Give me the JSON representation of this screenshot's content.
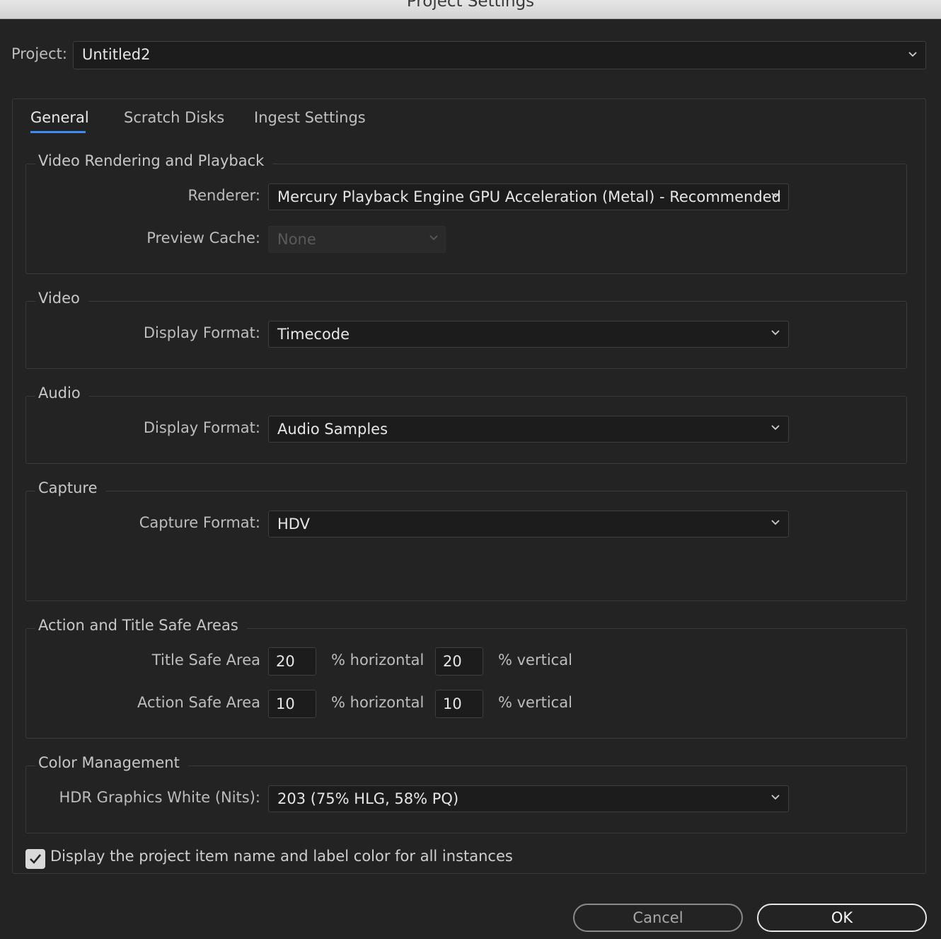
{
  "window": {
    "title": "Project Settings"
  },
  "project": {
    "label": "Project:",
    "value": "Untitled2"
  },
  "tabs": [
    {
      "label": "General",
      "active": true
    },
    {
      "label": "Scratch Disks",
      "active": false
    },
    {
      "label": "Ingest Settings",
      "active": false
    }
  ],
  "video_rendering": {
    "title": "Video Rendering and Playback",
    "renderer_label": "Renderer:",
    "renderer_value": "Mercury Playback Engine GPU Acceleration (Metal) - Recommended",
    "preview_cache_label": "Preview Cache:",
    "preview_cache_value": "None"
  },
  "video": {
    "title": "Video",
    "display_format_label": "Display Format:",
    "display_format_value": "Timecode"
  },
  "audio": {
    "title": "Audio",
    "display_format_label": "Display Format:",
    "display_format_value": "Audio Samples"
  },
  "capture": {
    "title": "Capture",
    "capture_format_label": "Capture Format:",
    "capture_format_value": "HDV"
  },
  "safe_areas": {
    "title": "Action and Title Safe Areas",
    "title_safe_label": "Title Safe Area",
    "title_safe_h": "20",
    "title_safe_v": "20",
    "action_safe_label": "Action Safe Area",
    "action_safe_h": "10",
    "action_safe_v": "10",
    "horizontal_unit": "% horizontal",
    "vertical_unit": "% vertical"
  },
  "color_management": {
    "title": "Color Management",
    "hdr_label": "HDR Graphics White (Nits):",
    "hdr_value": "203 (75% HLG, 58% PQ)"
  },
  "display_instances": {
    "checked": true,
    "label": "Display the project item name and label color for all instances"
  },
  "buttons": {
    "cancel": "Cancel",
    "ok": "OK"
  },
  "colors": {
    "accent": "#3b8cf5",
    "background": "#232323",
    "field": "#1c1c1c"
  }
}
